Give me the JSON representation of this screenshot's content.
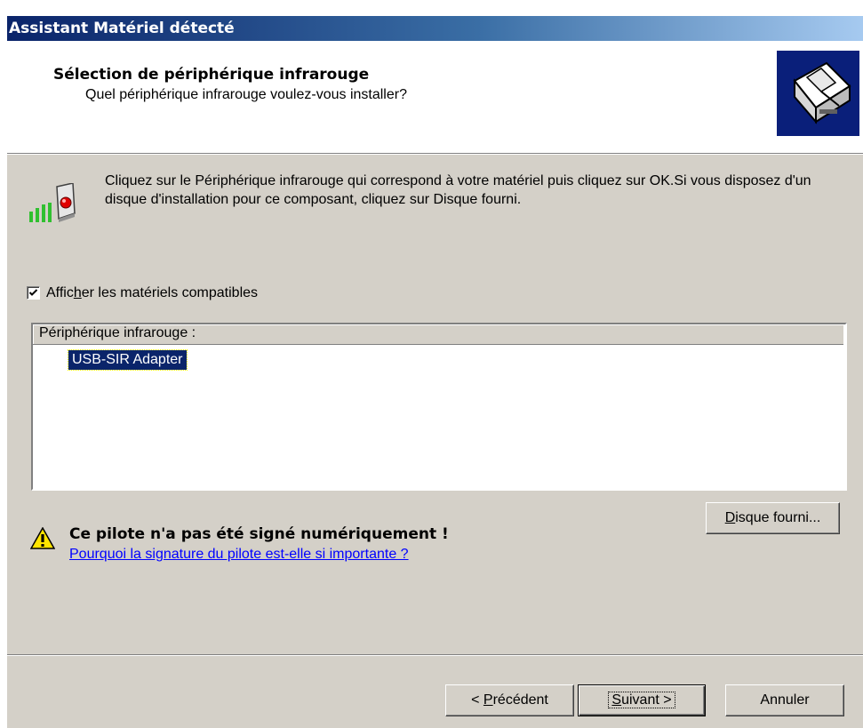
{
  "window": {
    "title": "Assistant Matériel détecté"
  },
  "header": {
    "title": "Sélection de périphérique infrarouge",
    "subtitle": "Quel périphérique infrarouge voulez-vous installer?"
  },
  "intro": {
    "icon": "infrared-device-icon",
    "text": "Cliquez sur le Périphérique infrarouge qui correspond à votre matériel puis cliquez sur OK.Si vous disposez d'un disque d'installation pour ce composant, cliquez sur Disque fourni."
  },
  "compatible": {
    "checked": true,
    "label_pre": "Affic",
    "label_accel": "h",
    "label_post": "er les matériels compatibles"
  },
  "device_list": {
    "header": "Périphérique infrarouge :",
    "items": [
      {
        "label": "USB-SIR Adapter",
        "selected": true
      }
    ]
  },
  "warning": {
    "icon": "warning-icon",
    "text": "Ce pilote n'a pas été signé numériquement !",
    "link": "Pourquoi la signature du pilote est-elle si importante ?"
  },
  "buttons": {
    "have_disk": {
      "accel": "D",
      "rest": "isque fourni..."
    },
    "back": {
      "pre": "< ",
      "accel": "P",
      "rest": "récédent"
    },
    "next": {
      "accel": "S",
      "rest": "uivant >"
    },
    "cancel": "Annuler"
  }
}
